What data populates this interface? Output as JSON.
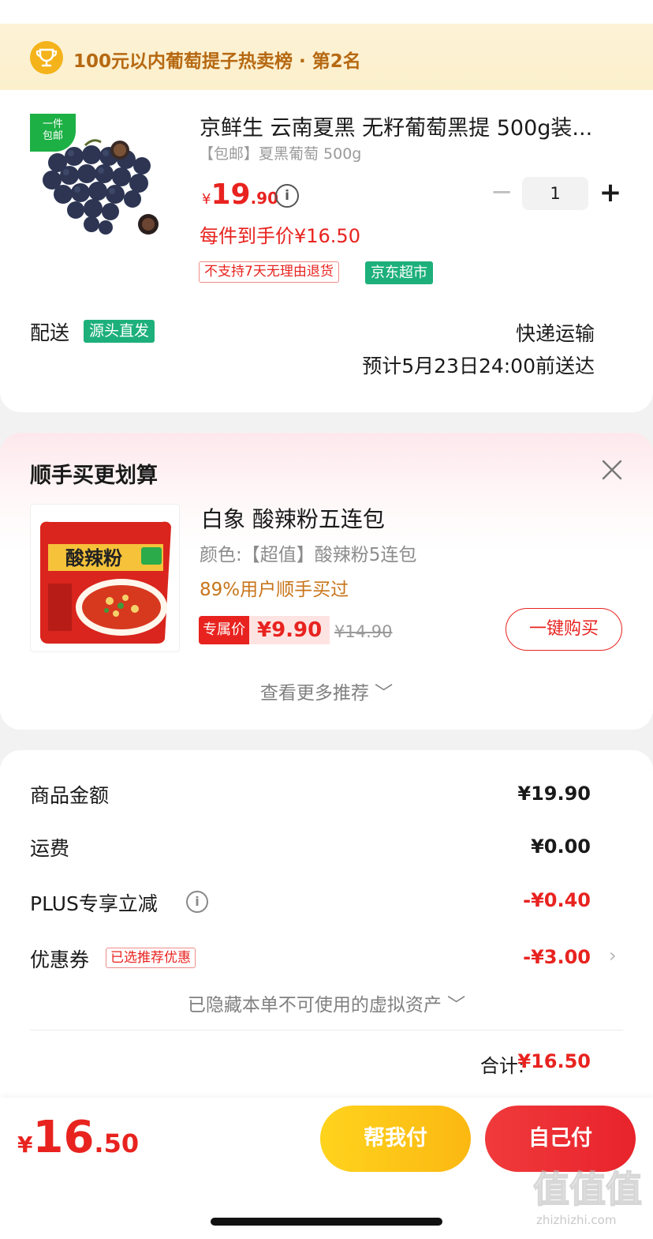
{
  "rank_banner": {
    "text": "100元以内葡萄提子热卖榜 · 第2名"
  },
  "product": {
    "image_tag": "一件\n包邮",
    "image_tag_line1": "一件",
    "image_tag_line2": "包邮",
    "title": "京鲜生 云南夏黑 无籽葡萄黑提 500g装...",
    "spec": "【包邮】夏黑葡萄 500g",
    "price_currency": "¥",
    "price_int": "19",
    "price_dec": ".90",
    "quantity": "1",
    "minus_label": "−",
    "plus_label": "+",
    "final_price": "每件到手价¥16.50",
    "tags": [
      "不支持7天无理由退货",
      "京东超市"
    ]
  },
  "delivery": {
    "label": "配送",
    "tag": "源头直发",
    "method": "快递运输",
    "eta": "预计5月23日24:00前送达"
  },
  "recommend": {
    "title": "顺手买更划算",
    "name": "白象 酸辣粉五连包",
    "spec": "颜色:【超值】酸辣粉5连包",
    "percent": "89%用户顺手买过",
    "price_label": "专属价",
    "price": "¥9.90",
    "original_price": "¥14.90",
    "buy_button": "一键购买",
    "more": "查看更多推荐 ﹀",
    "image_text": "酸辣粉"
  },
  "summary": {
    "rows": [
      {
        "label": "商品金额",
        "value": "¥19.90"
      },
      {
        "label": "运费",
        "value": "¥0.00"
      },
      {
        "label": "PLUS专享立减",
        "value": "-¥0.40"
      },
      {
        "label": "优惠券",
        "value": "-¥3.00"
      }
    ],
    "coupon_tag": "已选推荐优惠",
    "coupon_arrow": "›",
    "hidden_assets": "已隐藏本单不可使用的虚拟资产 ﹀",
    "total_label": "合计:",
    "total_value": "¥16.50"
  },
  "bottom": {
    "currency": "¥",
    "total_int": "16",
    "total_dec": ".50",
    "help_pay": "帮我付",
    "self_pay": "自己付"
  },
  "watermark": {
    "text": "值值值",
    "url": "zhizhizhi.com"
  },
  "colors": {
    "price_red": "#e8231f",
    "tag_green": "#1db07a",
    "banner_bg": "#fdf3d6",
    "banner_text": "#b66912",
    "help_pay_yellow": "#fbc418",
    "self_pay_red": "#ec2d33"
  },
  "icons": [
    "trophy-icon",
    "info-icon",
    "close-icon",
    "chevron-down-icon",
    "chevron-right-icon"
  ]
}
